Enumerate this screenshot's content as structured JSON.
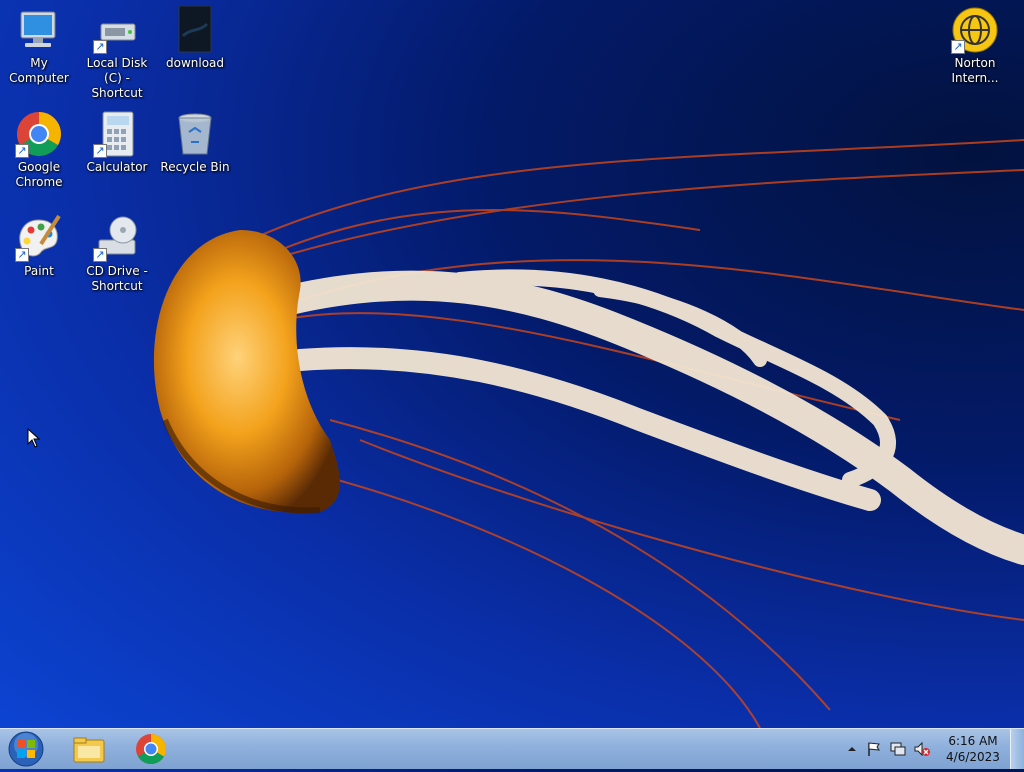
{
  "desktop": {
    "icons": [
      {
        "label": "My Computer"
      },
      {
        "label": "Local Disk (C) - Shortcut"
      },
      {
        "label": "download"
      },
      {
        "label": "Google Chrome"
      },
      {
        "label": "Calculator"
      },
      {
        "label": "Recycle Bin"
      },
      {
        "label": "Paint"
      },
      {
        "label": "CD Drive - Shortcut"
      },
      {
        "label": "Norton Intern..."
      }
    ]
  },
  "taskbar": {
    "start_icon": "windows-start-orb",
    "pinned": [
      {
        "icon": "windows-explorer-icon"
      },
      {
        "icon": "google-chrome-icon"
      }
    ],
    "tray": {
      "icons": [
        "show-hidden-icons",
        "action-center-flag-icon",
        "network-icon",
        "volume-muted-icon"
      ],
      "time": "6:16 AM",
      "date": "4/6/2023"
    }
  }
}
